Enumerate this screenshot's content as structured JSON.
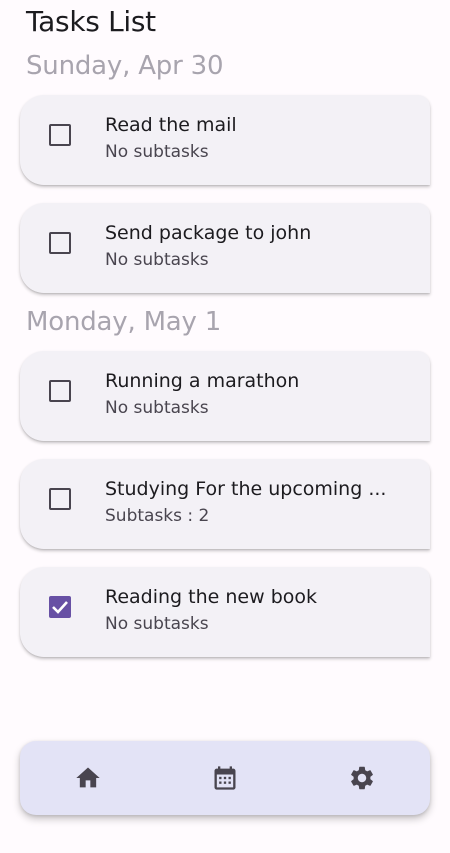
{
  "header": {
    "title": "Tasks List"
  },
  "sections": [
    {
      "date": "Sunday, Apr 30",
      "tasks": [
        {
          "title": "Read the mail",
          "subtitle": "No subtasks",
          "checked": false
        },
        {
          "title": "Send package to john",
          "subtitle": "No subtasks",
          "checked": false
        }
      ]
    },
    {
      "date": "Monday, May 1",
      "tasks": [
        {
          "title": "Running a marathon",
          "subtitle": "No subtasks",
          "checked": false
        },
        {
          "title": "Studying For the upcoming ...",
          "subtitle": "Subtasks : 2",
          "checked": false
        },
        {
          "title": "Reading the new book",
          "subtitle": "No subtasks",
          "checked": true
        }
      ]
    }
  ],
  "bottom_nav": {
    "items": [
      {
        "icon": "home-icon"
      },
      {
        "icon": "calendar-icon"
      },
      {
        "icon": "gear-icon"
      }
    ]
  },
  "colors": {
    "background": "#fffbfe",
    "card": "#f3f1f6",
    "accent": "#6750a4",
    "nav_background": "#e3e3f6",
    "date_heading": "#a8a4ae"
  }
}
